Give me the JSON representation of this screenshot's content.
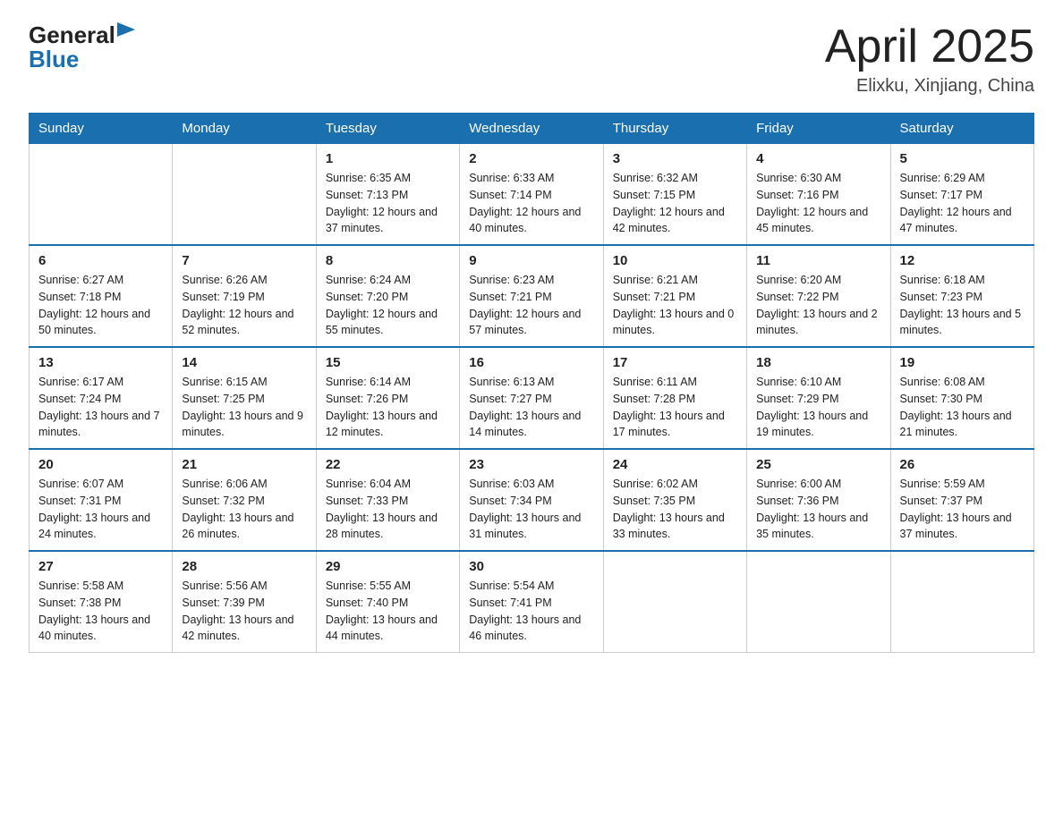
{
  "header": {
    "logo_general": "General",
    "logo_blue": "Blue",
    "month_title": "April 2025",
    "location": "Elixku, Xinjiang, China"
  },
  "weekdays": [
    "Sunday",
    "Monday",
    "Tuesday",
    "Wednesday",
    "Thursday",
    "Friday",
    "Saturday"
  ],
  "weeks": [
    [
      {
        "day": "",
        "sunrise": "",
        "sunset": "",
        "daylight": ""
      },
      {
        "day": "",
        "sunrise": "",
        "sunset": "",
        "daylight": ""
      },
      {
        "day": "1",
        "sunrise": "Sunrise: 6:35 AM",
        "sunset": "Sunset: 7:13 PM",
        "daylight": "Daylight: 12 hours and 37 minutes."
      },
      {
        "day": "2",
        "sunrise": "Sunrise: 6:33 AM",
        "sunset": "Sunset: 7:14 PM",
        "daylight": "Daylight: 12 hours and 40 minutes."
      },
      {
        "day": "3",
        "sunrise": "Sunrise: 6:32 AM",
        "sunset": "Sunset: 7:15 PM",
        "daylight": "Daylight: 12 hours and 42 minutes."
      },
      {
        "day": "4",
        "sunrise": "Sunrise: 6:30 AM",
        "sunset": "Sunset: 7:16 PM",
        "daylight": "Daylight: 12 hours and 45 minutes."
      },
      {
        "day": "5",
        "sunrise": "Sunrise: 6:29 AM",
        "sunset": "Sunset: 7:17 PM",
        "daylight": "Daylight: 12 hours and 47 minutes."
      }
    ],
    [
      {
        "day": "6",
        "sunrise": "Sunrise: 6:27 AM",
        "sunset": "Sunset: 7:18 PM",
        "daylight": "Daylight: 12 hours and 50 minutes."
      },
      {
        "day": "7",
        "sunrise": "Sunrise: 6:26 AM",
        "sunset": "Sunset: 7:19 PM",
        "daylight": "Daylight: 12 hours and 52 minutes."
      },
      {
        "day": "8",
        "sunrise": "Sunrise: 6:24 AM",
        "sunset": "Sunset: 7:20 PM",
        "daylight": "Daylight: 12 hours and 55 minutes."
      },
      {
        "day": "9",
        "sunrise": "Sunrise: 6:23 AM",
        "sunset": "Sunset: 7:21 PM",
        "daylight": "Daylight: 12 hours and 57 minutes."
      },
      {
        "day": "10",
        "sunrise": "Sunrise: 6:21 AM",
        "sunset": "Sunset: 7:21 PM",
        "daylight": "Daylight: 13 hours and 0 minutes."
      },
      {
        "day": "11",
        "sunrise": "Sunrise: 6:20 AM",
        "sunset": "Sunset: 7:22 PM",
        "daylight": "Daylight: 13 hours and 2 minutes."
      },
      {
        "day": "12",
        "sunrise": "Sunrise: 6:18 AM",
        "sunset": "Sunset: 7:23 PM",
        "daylight": "Daylight: 13 hours and 5 minutes."
      }
    ],
    [
      {
        "day": "13",
        "sunrise": "Sunrise: 6:17 AM",
        "sunset": "Sunset: 7:24 PM",
        "daylight": "Daylight: 13 hours and 7 minutes."
      },
      {
        "day": "14",
        "sunrise": "Sunrise: 6:15 AM",
        "sunset": "Sunset: 7:25 PM",
        "daylight": "Daylight: 13 hours and 9 minutes."
      },
      {
        "day": "15",
        "sunrise": "Sunrise: 6:14 AM",
        "sunset": "Sunset: 7:26 PM",
        "daylight": "Daylight: 13 hours and 12 minutes."
      },
      {
        "day": "16",
        "sunrise": "Sunrise: 6:13 AM",
        "sunset": "Sunset: 7:27 PM",
        "daylight": "Daylight: 13 hours and 14 minutes."
      },
      {
        "day": "17",
        "sunrise": "Sunrise: 6:11 AM",
        "sunset": "Sunset: 7:28 PM",
        "daylight": "Daylight: 13 hours and 17 minutes."
      },
      {
        "day": "18",
        "sunrise": "Sunrise: 6:10 AM",
        "sunset": "Sunset: 7:29 PM",
        "daylight": "Daylight: 13 hours and 19 minutes."
      },
      {
        "day": "19",
        "sunrise": "Sunrise: 6:08 AM",
        "sunset": "Sunset: 7:30 PM",
        "daylight": "Daylight: 13 hours and 21 minutes."
      }
    ],
    [
      {
        "day": "20",
        "sunrise": "Sunrise: 6:07 AM",
        "sunset": "Sunset: 7:31 PM",
        "daylight": "Daylight: 13 hours and 24 minutes."
      },
      {
        "day": "21",
        "sunrise": "Sunrise: 6:06 AM",
        "sunset": "Sunset: 7:32 PM",
        "daylight": "Daylight: 13 hours and 26 minutes."
      },
      {
        "day": "22",
        "sunrise": "Sunrise: 6:04 AM",
        "sunset": "Sunset: 7:33 PM",
        "daylight": "Daylight: 13 hours and 28 minutes."
      },
      {
        "day": "23",
        "sunrise": "Sunrise: 6:03 AM",
        "sunset": "Sunset: 7:34 PM",
        "daylight": "Daylight: 13 hours and 31 minutes."
      },
      {
        "day": "24",
        "sunrise": "Sunrise: 6:02 AM",
        "sunset": "Sunset: 7:35 PM",
        "daylight": "Daylight: 13 hours and 33 minutes."
      },
      {
        "day": "25",
        "sunrise": "Sunrise: 6:00 AM",
        "sunset": "Sunset: 7:36 PM",
        "daylight": "Daylight: 13 hours and 35 minutes."
      },
      {
        "day": "26",
        "sunrise": "Sunrise: 5:59 AM",
        "sunset": "Sunset: 7:37 PM",
        "daylight": "Daylight: 13 hours and 37 minutes."
      }
    ],
    [
      {
        "day": "27",
        "sunrise": "Sunrise: 5:58 AM",
        "sunset": "Sunset: 7:38 PM",
        "daylight": "Daylight: 13 hours and 40 minutes."
      },
      {
        "day": "28",
        "sunrise": "Sunrise: 5:56 AM",
        "sunset": "Sunset: 7:39 PM",
        "daylight": "Daylight: 13 hours and 42 minutes."
      },
      {
        "day": "29",
        "sunrise": "Sunrise: 5:55 AM",
        "sunset": "Sunset: 7:40 PM",
        "daylight": "Daylight: 13 hours and 44 minutes."
      },
      {
        "day": "30",
        "sunrise": "Sunrise: 5:54 AM",
        "sunset": "Sunset: 7:41 PM",
        "daylight": "Daylight: 13 hours and 46 minutes."
      },
      {
        "day": "",
        "sunrise": "",
        "sunset": "",
        "daylight": ""
      },
      {
        "day": "",
        "sunrise": "",
        "sunset": "",
        "daylight": ""
      },
      {
        "day": "",
        "sunrise": "",
        "sunset": "",
        "daylight": ""
      }
    ]
  ]
}
